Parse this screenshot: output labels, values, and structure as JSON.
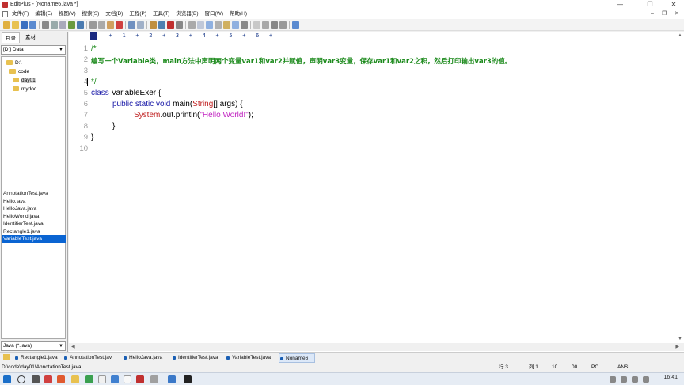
{
  "window": {
    "title": "EditPlus - [Noname6.java *]",
    "minimize": "—",
    "maximize": "❐",
    "close": "✕"
  },
  "menu": [
    "文件(F)",
    "编辑(E)",
    "视图(V)",
    "搜索(S)",
    "文档(D)",
    "工程(P)",
    "工具(T)",
    "浏览器(B)",
    "窗口(W)",
    "帮助(H)"
  ],
  "doc_buttons": {
    "minimize": "–",
    "restore": "❐",
    "close": "✕"
  },
  "left_panel": {
    "tabs": [
      "目录",
      "素材"
    ],
    "drive": "[D:] Data",
    "folders": [
      "D:\\",
      "code",
      "day01",
      "mydoc"
    ],
    "files": [
      "AnnotationTest.java",
      "Hello.java",
      "HelloJava.java",
      "HelloWorld.java",
      "IdentifierTest.java",
      "Rectangle1.java",
      "VariableTest.java"
    ],
    "filter": "Java (*.java)"
  },
  "editor": {
    "ruler": "———+———1———+———2———+———3———+———4———+———5———+———6———+———",
    "line_numbers": [
      "1",
      "2",
      "3",
      "4",
      "5",
      "6",
      "7",
      "8",
      "9",
      "10"
    ],
    "code": {
      "l1": "/*",
      "l2": "编写一个Variable类，main方法中声明两个变量var1和var2并赋值，声明var3变量，保存var1和var2之积，然后打印输出var3的值。",
      "l4": "*/",
      "l5_kw": "class",
      "l5_rest": " VariableExer {",
      "l6_kw": "public static void",
      "l6_a": " main(",
      "l6_cls": "String",
      "l6_b": "[] args) {",
      "l7_cls": "System",
      "l7_a": ".out.println(",
      "l7_str": "\"Hello World!\"",
      "l7_b": ");",
      "l8": "}",
      "l9": "}"
    }
  },
  "doc_tabs": [
    "Rectangle1.java",
    "AnnotationTest.jav",
    "HelloJava.java",
    "IdentifierTest.java",
    "VariableTest.java",
    "Noname6"
  ],
  "status": {
    "path": "D:\\code\\day01\\AnnotationTest.java",
    "row": "行 3",
    "col": "列 1",
    "num1": "10",
    "num2": "00",
    "mode": "PC",
    "encoding": "ANSI"
  },
  "taskbar": {
    "clock": "16:41"
  },
  "colors": {
    "keyword": "#1a1aa8",
    "class": "#c02020",
    "string": "#c020c0",
    "comment": "#1c8a1c",
    "selection": "#0a64d2"
  }
}
